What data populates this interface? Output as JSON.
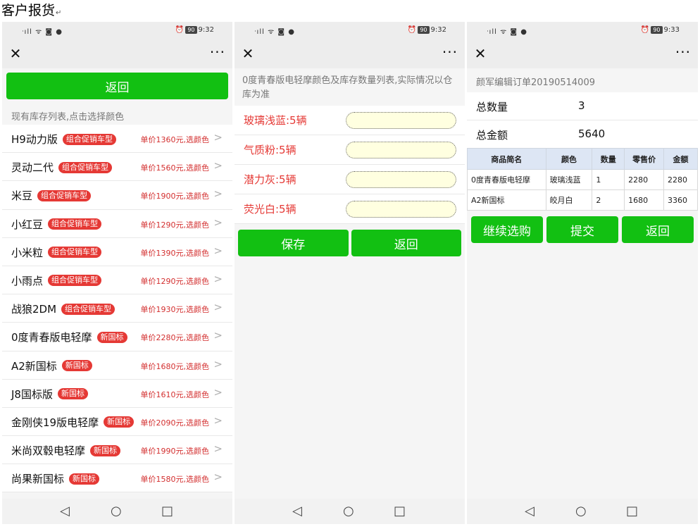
{
  "doc_title": "客户报货",
  "doc_title_mark": "↵",
  "status": {
    "signal": "ᐧıll ᯤ ◙ ●",
    "alarm": "⏰",
    "battery": "90",
    "time1": "9:32",
    "time2": "9:32",
    "time3": "9:33"
  },
  "nav": {
    "close": "✕",
    "more": "···"
  },
  "panel1": {
    "back_label": "返回",
    "hint": "现有库存列表,点击选择颜色",
    "items": [
      {
        "name": "H9动力版",
        "tag": "组合促销车型",
        "price": "单价1360元,选颜色"
      },
      {
        "name": "灵动二代",
        "tag": "组合促销车型",
        "price": "单价1560元,选颜色"
      },
      {
        "name": "米豆",
        "tag": "组合促销车型",
        "price": "单价1900元,选颜色"
      },
      {
        "name": "小红豆",
        "tag": "组合促销车型",
        "price": "单价1290元,选颜色"
      },
      {
        "name": "小米粒",
        "tag": "组合促销车型",
        "price": "单价1390元,选颜色"
      },
      {
        "name": "小雨点",
        "tag": "组合促销车型",
        "price": "单价1290元,选颜色"
      },
      {
        "name": "战狼2DM",
        "tag": "组合促销车型",
        "price": "单价1930元,选颜色"
      },
      {
        "name": "0度青春版电轻摩",
        "tag": "新国标",
        "price": "单价2280元,选颜色"
      },
      {
        "name": "A2新国标",
        "tag": "新国标",
        "price": "单价1680元,选颜色"
      },
      {
        "name": "J8国标版",
        "tag": "新国标",
        "price": "单价1610元,选颜色"
      },
      {
        "name": "金刚侠19版电轻摩",
        "tag": "新国标",
        "price": "单价2090元,选颜色"
      },
      {
        "name": "米尚双毂电轻摩",
        "tag": "新国标",
        "price": "单价1990元,选颜色"
      },
      {
        "name": "尚果新国标",
        "tag": "新国标",
        "price": "单价1580元,选颜色"
      }
    ]
  },
  "panel2": {
    "description": "0度青春版电轻摩颜色及库存数量列表,实际情况以仓库为准",
    "colors": [
      {
        "label": "玻璃浅蓝:5辆",
        "value": ""
      },
      {
        "label": "气质粉:5辆",
        "value": ""
      },
      {
        "label": "潜力灰:5辆",
        "value": ""
      },
      {
        "label": "荧光白:5辆",
        "value": ""
      }
    ],
    "save_label": "保存",
    "back_label": "返回"
  },
  "panel3": {
    "order_no": "颜军编辑订单20190514009",
    "total_qty_label": "总数量",
    "total_qty": "3",
    "total_amount_label": "总金额",
    "total_amount": "5640",
    "columns": [
      "商品简名",
      "颜色",
      "数量",
      "零售价",
      "金额"
    ],
    "rows": [
      [
        "0度青春版电轻摩",
        "玻璃浅蓝",
        "1",
        "2280",
        "2280"
      ],
      [
        "A2新国标",
        "皎月白",
        "2",
        "1680",
        "3360"
      ]
    ],
    "continue_label": "继续选购",
    "submit_label": "提交",
    "back_label": "返回"
  },
  "sysnav": {
    "back": "◁",
    "home": "○",
    "recent": "□"
  },
  "colors": {
    "accent_green": "#12c012",
    "tag_red": "#e53935",
    "price_red": "#d32f2f",
    "input_fill": "#ffffe0"
  }
}
